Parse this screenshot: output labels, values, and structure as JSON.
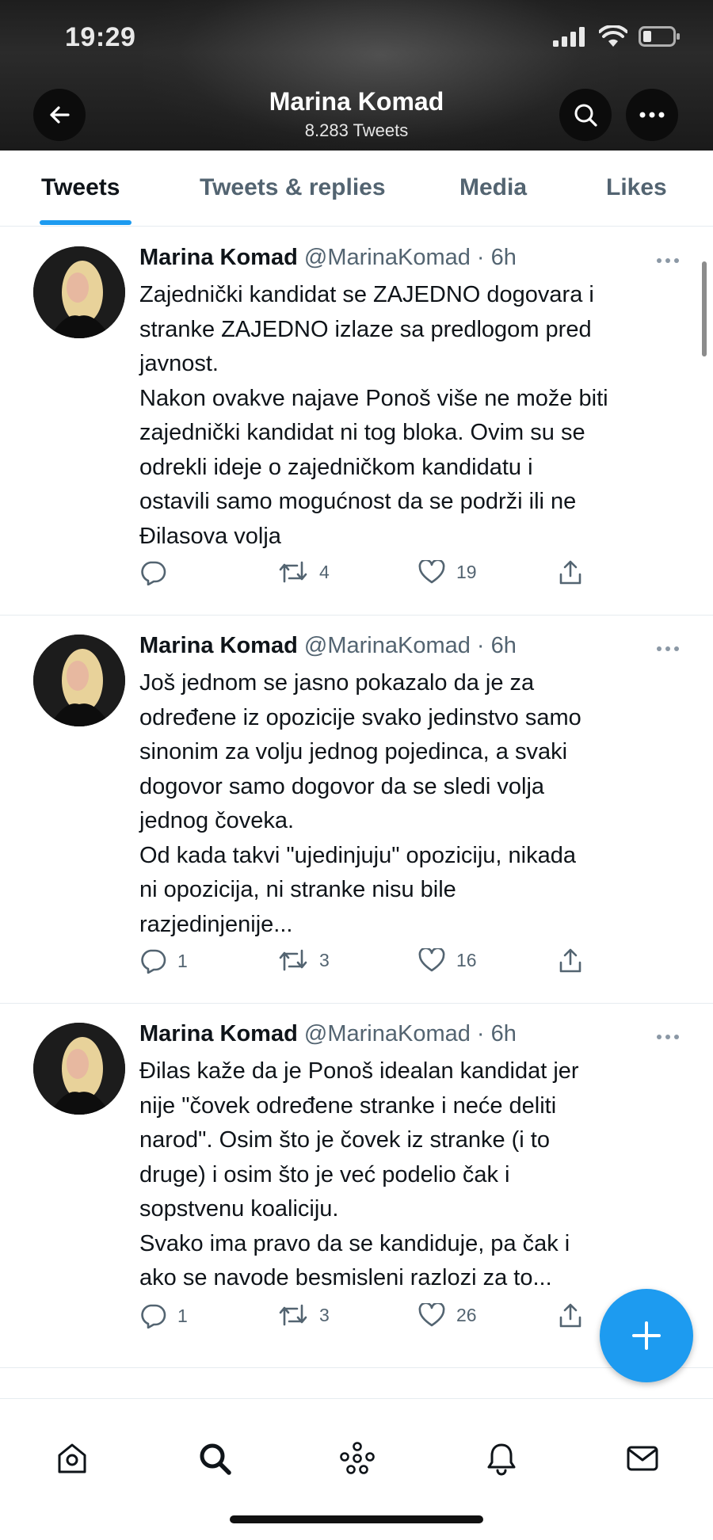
{
  "status_bar": {
    "time": "19:29"
  },
  "profile": {
    "name": "Marina Komad",
    "tweet_count": "8.283 Tweets"
  },
  "tabs": [
    {
      "label": "Tweets"
    },
    {
      "label": "Tweets & replies"
    },
    {
      "label": "Media"
    },
    {
      "label": "Likes"
    }
  ],
  "tweets": [
    {
      "name": "Marina Komad",
      "handle": "@MarinaKomad · 6h",
      "lines": [
        "Zajednički kandidat se ZAJEDNO dogovara i",
        "stranke ZAJEDNO izlaze sa predlogom pred",
        "javnost.",
        "Nakon ovakve najave Ponoš više ne može biti",
        "zajednički kandidat ni tog bloka. Ovim su se",
        "odrekli ideje o zajedničkom kandidatu i",
        "ostavili samo mogućnost da se podrži ili ne",
        "Đilasova volja"
      ],
      "replies": "",
      "retweets": "4",
      "likes": "19"
    },
    {
      "name": "Marina Komad",
      "handle": "@MarinaKomad · 6h",
      "lines": [
        "Još jednom se jasno pokazalo da je za",
        "određene iz opozicije svako jedinstvo samo",
        "sinonim za volju jednog pojedinca, a svaki",
        "dogovor samo dogovor da se sledi volja",
        "jednog čoveka.",
        "Od kada takvi \"ujedinjuju\" opoziciju, nikada",
        "ni opozicija, ni stranke nisu bile",
        "razjedinjenije..."
      ],
      "replies": "1",
      "retweets": "3",
      "likes": "16"
    },
    {
      "name": "Marina Komad",
      "handle": "@MarinaKomad · 6h",
      "lines": [
        "Đilas kaže da je Ponoš idealan kandidat jer",
        "nije \"čovek određene stranke i neće deliti",
        "narod\". Osim što je čovek iz stranke (i to",
        "druge) i osim što je već podelio čak i",
        "sopstvenu koaliciju.",
        "Svako ima pravo da se kandiduje, pa čak i",
        "ako se navode besmisleni razlozi za to..."
      ],
      "replies": "1",
      "retweets": "3",
      "likes": "26"
    }
  ],
  "colors": {
    "accent": "#1d9bf0",
    "secondary_text": "#536471",
    "primary_text": "#0f1419"
  },
  "bottom_nav": [
    "home-icon",
    "search-icon",
    "spaces-icon",
    "notifications-icon",
    "messages-icon"
  ]
}
